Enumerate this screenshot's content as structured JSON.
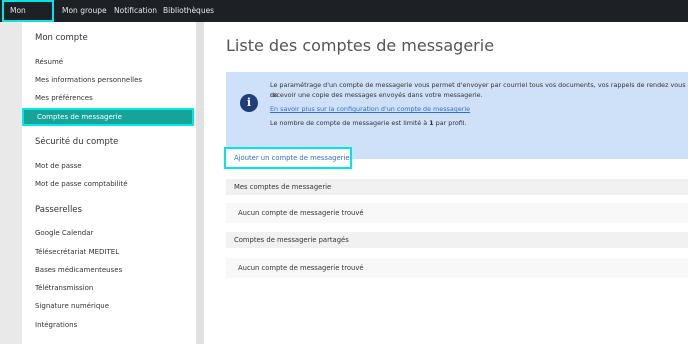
{
  "topnav": {
    "items": [
      "Mon compte",
      "Mon groupe",
      "Notification",
      "Bibliothèques"
    ]
  },
  "sidebar": {
    "sections": [
      {
        "heading": "Mon compte",
        "items": [
          "Résumé",
          "Mes informations personnelles",
          "Mes préférences",
          "Comptes de messagerie"
        ]
      },
      {
        "heading": "Sécurité du compte",
        "items": [
          "Mot de passe",
          "Mot de passe comptabilité"
        ]
      },
      {
        "heading": "Passerelles",
        "items": [
          "Google Calendar",
          "Télésecrétariat MEDITEL",
          "Bases médicamenteuses",
          "Télétransmission",
          "Signature numérique",
          "Intégrations"
        ]
      }
    ]
  },
  "main": {
    "title": "Liste des comptes de messagerie",
    "info": {
      "icon": "info-icon",
      "line1": "Le paramétrage d'un compte de messagerie vous permet d'envoyer par courriel tous vos documents, vos rappels de rendez vous et de",
      "line1b": "recevoir une copie des messages envoyés dans votre messagerie.",
      "link": "En savoir plus sur la configuration d'un compte de messagerie",
      "limit_prefix": "Le nombre de compte de messagerie est limité à ",
      "limit_value": "1",
      "limit_suffix": " par profil."
    },
    "add_button": "Ajouter un compte de messagerie",
    "my_accounts": {
      "heading": "Mes comptes de messagerie",
      "empty": "Aucun compte de messagerie trouvé"
    },
    "shared_accounts": {
      "heading": "Comptes de messagerie partagés",
      "empty": "Aucun compte de messagerie trouvé"
    }
  },
  "colors": {
    "topbar": "#1d2024",
    "highlight": "#00e5e5",
    "active_item": "#16a39a",
    "info_bg": "#cfe1f8",
    "link": "#2e6fd0"
  }
}
